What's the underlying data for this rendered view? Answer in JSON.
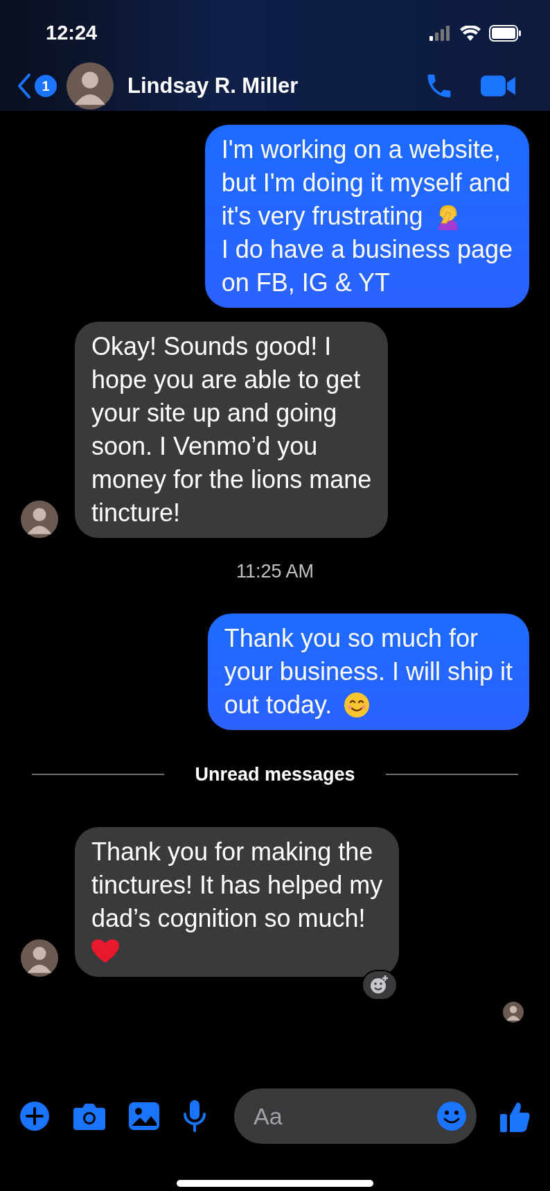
{
  "status_bar": {
    "time": "12:24"
  },
  "header": {
    "unread_badge": "1",
    "contact_name": "Lindsay R. Miller"
  },
  "messages": [
    {
      "kind": "sent",
      "parts": [
        {
          "kind": "text",
          "text": "I'm working on a website,"
        },
        {
          "kind": "text",
          "text": "but I'm doing it myself and"
        },
        {
          "kind": "text",
          "text": "it's very frustrating"
        },
        {
          "kind": "facepalm"
        },
        {
          "kind": "text",
          "text": "I do have a business page"
        },
        {
          "kind": "text",
          "text": "on FB, IG & YT"
        }
      ]
    },
    {
      "kind": "received",
      "parts": [
        {
          "kind": "text",
          "text": "Okay! Sounds good! I"
        },
        {
          "kind": "text",
          "text": "hope you are able to get"
        },
        {
          "kind": "text",
          "text": "your site up and going"
        },
        {
          "kind": "text",
          "text": "soon. I Venmo’d you"
        },
        {
          "kind": "text",
          "text": "money for the lions mane"
        },
        {
          "kind": "text",
          "text": "tincture!"
        }
      ]
    },
    {
      "kind": "timestamp",
      "text": "11:25 AM"
    },
    {
      "kind": "sent",
      "parts": [
        {
          "kind": "text",
          "text": "Thank you so much for"
        },
        {
          "kind": "text",
          "text": "your business. I will ship it"
        },
        {
          "kind": "text",
          "text": "out today."
        },
        {
          "kind": "smile"
        }
      ]
    },
    {
      "kind": "divider",
      "text": "Unread messages"
    },
    {
      "kind": "received",
      "reaction_button": true,
      "parts": [
        {
          "kind": "text",
          "text": "Thank you for making the"
        },
        {
          "kind": "text",
          "text": "tinctures! It has helped my"
        },
        {
          "kind": "text",
          "text": "dad’s cognition so much!"
        },
        {
          "kind": "heart"
        }
      ]
    }
  ],
  "composer": {
    "placeholder": "Aa"
  }
}
